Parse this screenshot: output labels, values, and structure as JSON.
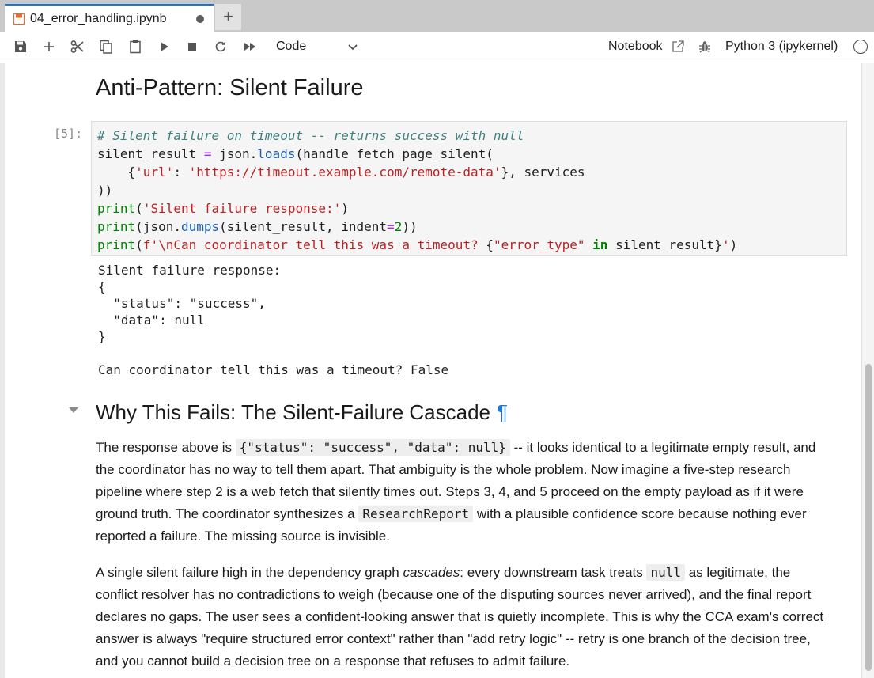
{
  "tab": {
    "title": "04_error_handling.ipynb"
  },
  "toolbar": {
    "cell_type": "Code",
    "notebook_label": "Notebook",
    "kernel_name": "Python 3 (ipykernel)"
  },
  "cells": {
    "heading_top": "Anti-Pattern: Silent Failure",
    "code_prompt": "[5]:",
    "output_lines": "Silent failure response:\n{\n  \"status\": \"success\",\n  \"data\": null\n}\n\nCan coordinator tell this was a timeout? False",
    "heading_why": "Why This Fails: The Silent-Failure Cascade",
    "pilcrow": "¶",
    "p1": {
      "t1": "The response above is ",
      "code1": "{\"status\": \"success\", \"data\": null}",
      "t2": " -- it looks identical to a legitimate empty result, and the coordinator has no way to tell them apart. That ambiguity is the whole problem. Now imagine a five-step research pipeline where step 2 is a web fetch that silently times out. Steps 3, 4, and 5 proceed on the empty payload as if it were ground truth. The coordinator synthesizes a ",
      "code2": "ResearchReport",
      "t3": " with a plausible confidence score because nothing ever reported a failure. The missing source is invisible."
    },
    "p2": {
      "t1": "A single silent failure high in the dependency graph ",
      "em": "cascades",
      "t2": ": every downstream task treats ",
      "code1": "null",
      "t3": " as legitimate, the conflict resolver has no contradictions to weigh (because one of the disputing sources never arrived), and the final report declares no gaps. The user sees a confident-looking answer that is quietly incomplete. This is why the CCA exam's correct answer is always \"require structured error context\" rather than \"add retry logic\" -- retry is one branch of the decision tree, and you cannot build a decision tree on a response that refuses to admit failure."
    }
  },
  "colors": {
    "accent": "#1976d2",
    "tab_bg": "#c9c9c9",
    "code_bg": "#f5f5f5"
  }
}
